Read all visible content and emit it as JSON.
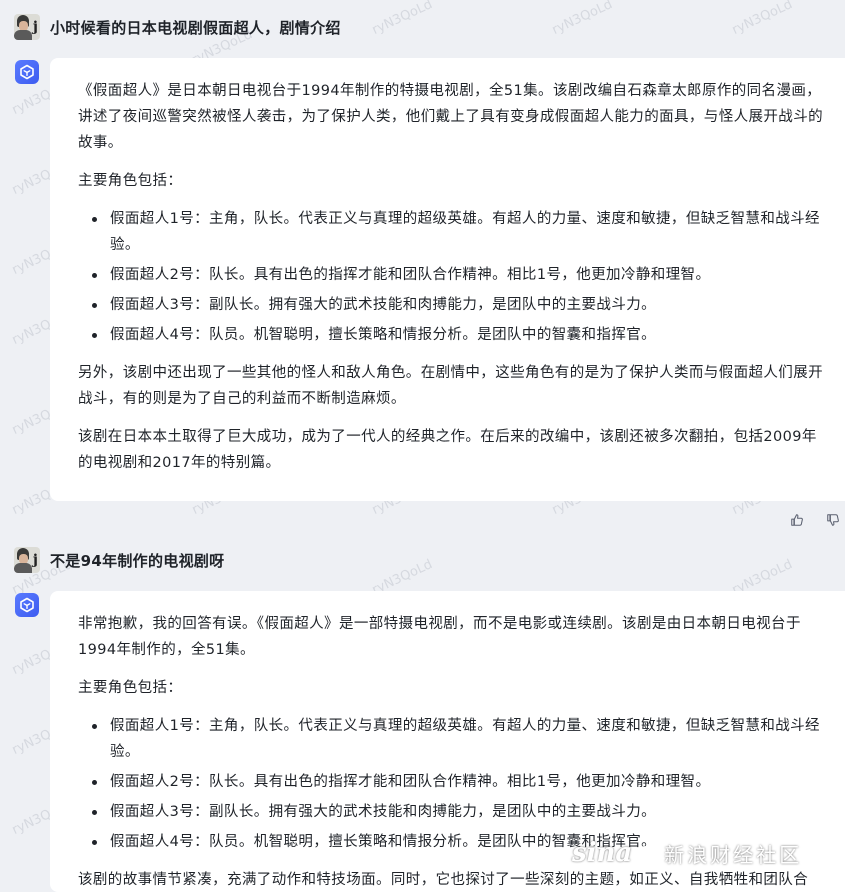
{
  "conversation": {
    "q1": "小时候看的日本电视剧假面超人，剧情介绍",
    "a1": {
      "intro": "《假面超人》是日本朝日电视台于1994年制作的特摄电视剧，全51集。该剧改编自石森章太郎原作的同名漫画，讲述了夜间巡警突然被怪人袭击，为了保护人类，他们戴上了具有变身成假面超人能力的面具，与怪人展开战斗的故事。",
      "roles_heading": "主要角色包括：",
      "roles": [
        "假面超人1号：主角，队长。代表正义与真理的超级英雄。有超人的力量、速度和敏捷，但缺乏智慧和战斗经验。",
        "假面超人2号：队长。具有出色的指挥才能和团队合作精神。相比1号，他更加冷静和理智。",
        "假面超人3号：副队长。拥有强大的武术技能和肉搏能力，是团队中的主要战斗力。",
        "假面超人4号：队员。机智聪明，擅长策略和情报分析。是团队中的智囊和指挥官。"
      ],
      "para2": "另外，该剧中还出现了一些其他的怪人和敌人角色。在剧情中，这些角色有的是为了保护人类而与假面超人们展开战斗，有的则是为了自己的利益而不断制造麻烦。",
      "para3": "该剧在日本本土取得了巨大成功，成为了一代人的经典之作。在后来的改编中，该剧还被多次翻拍，包括2009年的电视剧和2017年的特别篇。"
    },
    "q2": "不是94年制作的电视剧呀",
    "a2": {
      "intro": "非常抱歉，我的回答有误。《假面超人》是一部特摄电视剧，而不是电影或连续剧。该剧是由日本朝日电视台于1994年制作的，全51集。",
      "roles_heading": "主要角色包括：",
      "roles": [
        "假面超人1号：主角，队长。代表正义与真理的超级英雄。有超人的力量、速度和敏捷，但缺乏智慧和战斗经验。",
        "假面超人2号：队长。具有出色的指挥才能和团队合作精神。相比1号，他更加冷静和理智。",
        "假面超人3号：副队长。拥有强大的武术技能和肉搏能力，是团队中的主要战斗力。",
        "假面超人4号：队员。机智聪明，擅长策略和情报分析。是团队中的智囊和指挥官。"
      ],
      "para2": "该剧的故事情节紧凑，充满了动作和特技场面。同时，它也探讨了一些深刻的主题，如正义、自我牺牲和团队合"
    }
  },
  "icons": {
    "like": "thumbs-up-icon",
    "dislike": "thumbs-down-icon",
    "bot": "bot-cube-icon",
    "user": "user-avatar"
  },
  "watermark": {
    "text": "ryN3QoLd",
    "color": "#aab0ba"
  },
  "overlay": {
    "logo": "sina",
    "name": "新浪财经社区"
  },
  "colors": {
    "accent": "#4a6cf7",
    "background": "#eef0f4",
    "card": "#ffffff"
  }
}
